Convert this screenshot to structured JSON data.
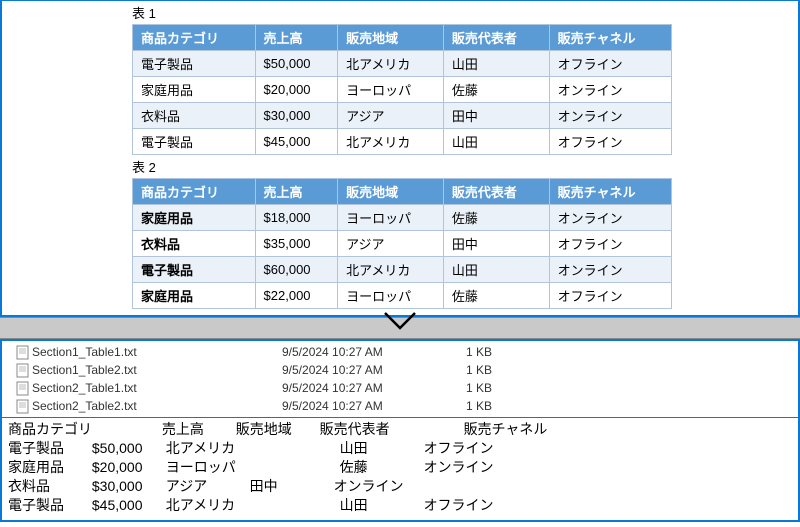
{
  "table1": {
    "title": "表 1",
    "headers": [
      "商品カテゴリ",
      "売上高",
      "販売地域",
      "販売代表者",
      "販売チャネル"
    ],
    "rows": [
      [
        "電子製品",
        "$50,000",
        "北アメリカ",
        "山田",
        "オフライン"
      ],
      [
        "家庭用品",
        "$20,000",
        "ヨーロッパ",
        "佐藤",
        "オンライン"
      ],
      [
        "衣料品",
        "$30,000",
        "アジア",
        "田中",
        "オンライン"
      ],
      [
        "電子製品",
        "$45,000",
        "北アメリカ",
        "山田",
        "オフライン"
      ]
    ]
  },
  "table2": {
    "title": "表 2",
    "headers": [
      "商品カテゴリ",
      "売上高",
      "販売地域",
      "販売代表者",
      "販売チャネル"
    ],
    "rows": [
      [
        "家庭用品",
        "$18,000",
        "ヨーロッパ",
        "佐藤",
        "オンライン"
      ],
      [
        "衣料品",
        "$35,000",
        "アジア",
        "田中",
        "オフライン"
      ],
      [
        "電子製品",
        "$60,000",
        "北アメリカ",
        "山田",
        "オンライン"
      ],
      [
        "家庭用品",
        "$22,000",
        "ヨーロッパ",
        "佐藤",
        "オフライン"
      ]
    ]
  },
  "files": [
    {
      "name": "Section1_Table1.txt",
      "date": "9/5/2024 10:27 AM",
      "size": "1 KB"
    },
    {
      "name": "Section1_Table2.txt",
      "date": "9/5/2024 10:27 AM",
      "size": "1 KB"
    },
    {
      "name": "Section2_Table1.txt",
      "date": "9/5/2024 10:27 AM",
      "size": "1 KB"
    },
    {
      "name": "Section2_Table2.txt",
      "date": "9/5/2024 10:27 AM",
      "size": "1 KB"
    }
  ],
  "preview": {
    "header": [
      "商品カテゴリ",
      "売上高",
      "販売地域",
      "販売代表者",
      "販売チャネル"
    ],
    "rows": [
      [
        "電子製品",
        "$50,000",
        "北アメリカ",
        "山田",
        "オフライン"
      ],
      [
        "家庭用品",
        "$20,000",
        "ヨーロッパ",
        "佐藤",
        "オンライン"
      ],
      [
        "衣料品",
        "$30,000",
        "アジア",
        "田中",
        "オンライン"
      ],
      [
        "電子製品",
        "$45,000",
        "北アメリカ",
        "山田",
        "オフライン"
      ]
    ]
  }
}
